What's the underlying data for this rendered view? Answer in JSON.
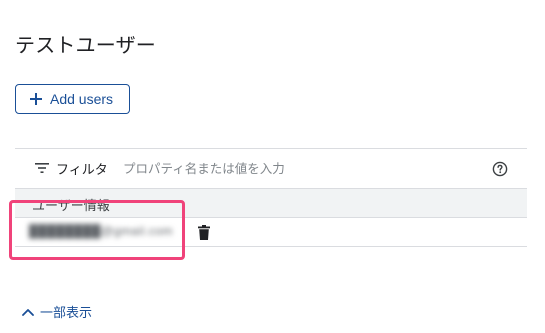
{
  "page": {
    "title": "テストユーザー"
  },
  "actions": {
    "add_users_label": "Add users"
  },
  "filter": {
    "label": "フィルタ",
    "placeholder": "プロパティ名または値を入力"
  },
  "table": {
    "columns": [
      "ユーザー情報"
    ],
    "rows": [
      {
        "email": "████████@gmail.com"
      }
    ]
  },
  "footer": {
    "toggle_label": "一部表示"
  },
  "colors": {
    "accent": "#1a4f97",
    "highlight": "#f0437a",
    "header_bg": "#f1f3f4",
    "divider": "#dadce0"
  },
  "icons": {
    "add": "plus-icon",
    "filter": "filter-icon",
    "help": "help-icon",
    "delete": "trash-icon",
    "toggle": "chevron-up-icon"
  }
}
